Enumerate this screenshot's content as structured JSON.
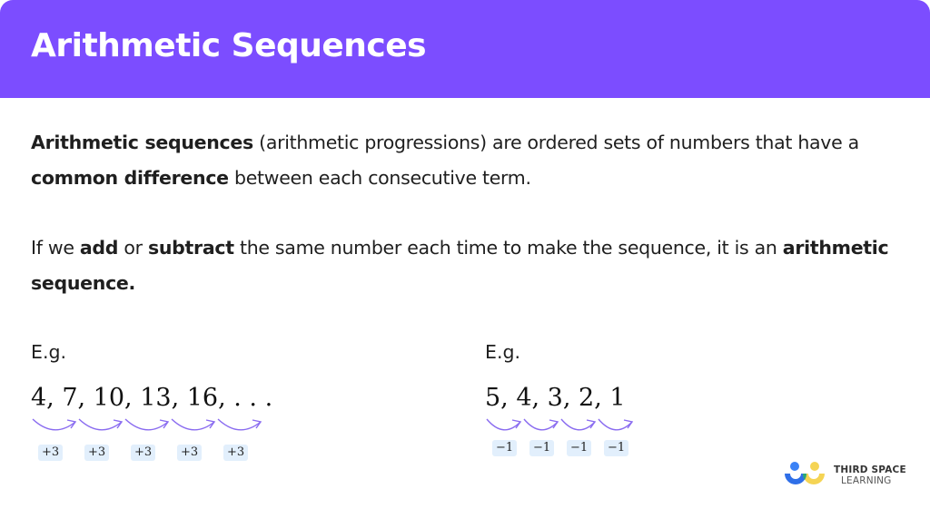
{
  "header": {
    "title": "Arithmetic Sequences",
    "color": "#7c4dff"
  },
  "intro": {
    "p1": {
      "bold1": "Arithmetic sequences",
      "text1": " (arithmetic progressions) are ordered sets of numbers that have a ",
      "bold2": "common difference",
      "text2": " between each consecutive term."
    },
    "p2": {
      "text1": "If we ",
      "bold1": "add",
      "text2": " or ",
      "bold2": "subtract",
      "text3": " the same number each time to make the sequence, it is an ",
      "bold3": "arithmetic sequence."
    }
  },
  "examples": [
    {
      "label": "E.g.",
      "sequence": "4,  7,  10,  13,  16, . . .",
      "terms": [
        "4",
        "7",
        "10",
        "13",
        "16"
      ],
      "differences": [
        "+3",
        "+3",
        "+3",
        "+3",
        "+3"
      ]
    },
    {
      "label": "E.g.",
      "sequence": "5,  4,  3,  2,  1",
      "terms": [
        "5",
        "4",
        "3",
        "2",
        "1"
      ],
      "differences": [
        "−1",
        "−1",
        "−1",
        "−1"
      ]
    }
  ],
  "colors": {
    "arrow": "#8a6cf0",
    "badge_bg": "#e2effc"
  },
  "logo": {
    "line1": "THIRD SPACE",
    "line2": "LEARNING"
  }
}
